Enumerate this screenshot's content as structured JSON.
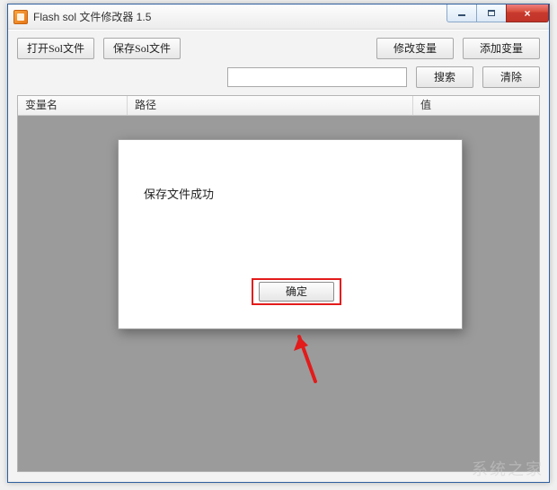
{
  "window": {
    "title": "Flash sol 文件修改器 1.5"
  },
  "toolbar": {
    "open_label": "打开Sol文件",
    "save_label": "保存Sol文件",
    "modify_var_label": "修改变量",
    "add_var_label": "添加变量"
  },
  "search": {
    "value": "",
    "placeholder": "",
    "search_label": "搜索",
    "clear_label": "清除"
  },
  "columns": {
    "name": "变量名",
    "path": "路径",
    "value": "值"
  },
  "modal": {
    "message": "保存文件成功",
    "ok_label": "确定"
  },
  "watermark": "系统之家"
}
